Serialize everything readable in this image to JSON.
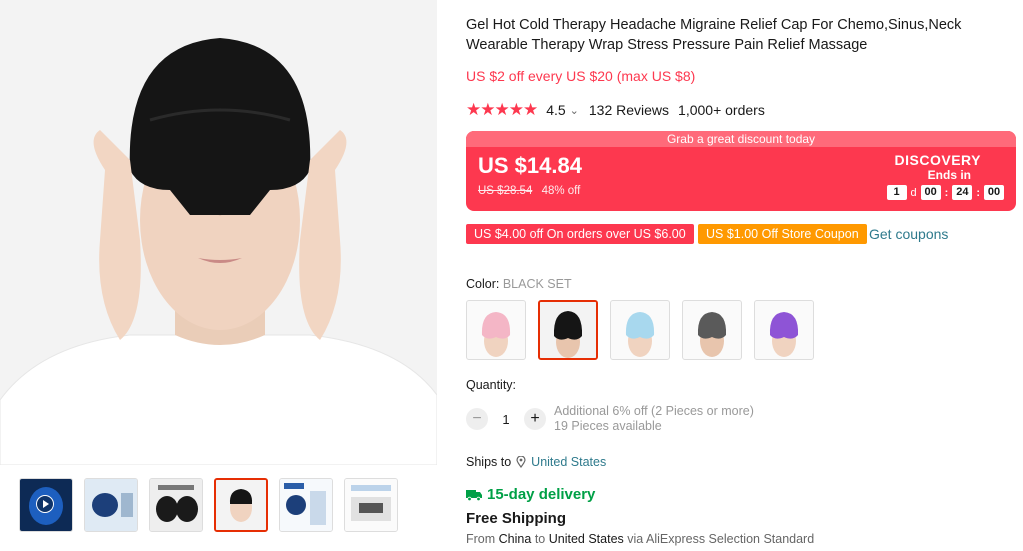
{
  "product": {
    "title": "Gel Hot Cold Therapy Headache Migraine Relief Cap For Chemo,Sinus,Neck Wearable Therapy Wrap Stress Pressure Pain Relief Massage",
    "promo_line": "US $2 off every US $20 (max US $8)",
    "stars": "★★★★★",
    "rating": "4.5",
    "rating_caret": "⌄",
    "reviews": "132 Reviews",
    "orders": "1,000+ orders"
  },
  "price_box": {
    "banner": "Grab a great discount today",
    "price": "US $14.84",
    "original": "US $28.54",
    "discount": "48% off",
    "campaign": "DISCOVERY",
    "ends_in": "Ends in",
    "timer": {
      "days": "1",
      "days_label": "d",
      "hours": "00",
      "minutes": "24",
      "seconds": "00"
    }
  },
  "coupons": {
    "coupon1": "US $4.00 off On orders over US $6.00",
    "coupon2": "US $1.00 Off Store Coupon",
    "get_coupons": "Get coupons"
  },
  "color": {
    "label": "Color: ",
    "selected": "BLACK SET",
    "options": [
      "pink",
      "black",
      "light-blue",
      "gray",
      "purple"
    ],
    "swatch_colors": [
      "#f4b6c6",
      "#151515",
      "#a8d8ee",
      "#5a5a5a",
      "#8e54d6"
    ],
    "selected_index": 1
  },
  "quantity": {
    "label": "Quantity:",
    "minus": "−",
    "plus": "+",
    "value": "1",
    "note1": "Additional 6% off (2 Pieces or more)",
    "note2": "19 Pieces available"
  },
  "shipping": {
    "ships_to": "Ships to",
    "country": "United States",
    "delivery": "15-day delivery",
    "free": "Free Shipping",
    "from_prefix": "From",
    "from_country": "China",
    "to_word": "to",
    "to_country": "United States",
    "via": "via AliExpress Selection Standard"
  },
  "gallery": {
    "thumb_count": 6,
    "active_thumb": 3
  },
  "colors": {
    "accent": "#fd384f",
    "link": "#2e7a8c",
    "delivery": "#00a046",
    "coupon_orange": "#ff9900"
  }
}
